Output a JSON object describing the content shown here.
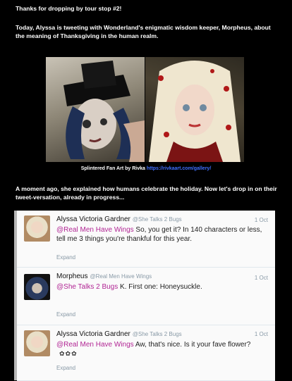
{
  "intro": {
    "p1": "Thanks for dropping by tour stop #2!",
    "p2": "Today, Alyssa is tweeting with Wonderland's enigmatic wisdom keeper, Morpheus, about the meaning of Thanksgiving in the human realm.",
    "caption_prefix": "Splintered Fan Art by Rivka",
    "caption_link": "https://rivkaart.com/gallery/",
    "p3": "A moment ago, she explained how humans celebrate the holiday. Now let's drop in on their tweet-versation, already in progress..."
  },
  "tweets": [
    {
      "name": "Alyssa Victoria Gardner",
      "handle": "@She Talks 2 Bugs",
      "date": "1 Oct",
      "mention": "@Real Men Have Wings",
      "text": " So, you get it? In 140 characters or less, tell me 3 things you're thankful for this year.",
      "expand": "Expand"
    },
    {
      "name": "Morpheus",
      "handle": "@Real Men Have Wings",
      "date": "1 Oct",
      "mention": "@She Talks 2 Bugs",
      "text": " K. First one: Honeysuckle.",
      "expand": "Expand"
    },
    {
      "name": "Alyssa Victoria Gardner",
      "handle": "@She Talks 2 Bugs",
      "date": "1 Oct",
      "mention": "@Real Men Have Wings",
      "text": " Aw, that's nice. Is it your fave flower?",
      "stars": "✿✿✿",
      "expand": "Expand"
    }
  ],
  "colors": {
    "link": "#3f6fff",
    "mention": "#b12594",
    "meta": "#8899a6"
  }
}
